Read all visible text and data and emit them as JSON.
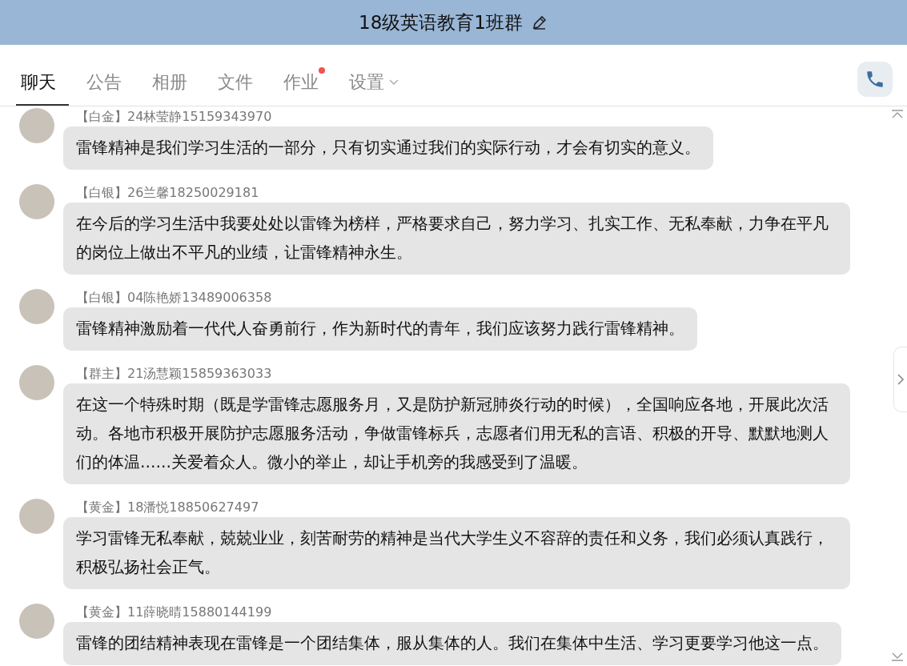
{
  "window": {
    "title": "18级英语教育1班群"
  },
  "tabs": [
    {
      "label": "聊天",
      "selected": true,
      "has_dot": false,
      "has_menu": false
    },
    {
      "label": "公告",
      "selected": false,
      "has_dot": false,
      "has_menu": false
    },
    {
      "label": "相册",
      "selected": false,
      "has_dot": false,
      "has_menu": false
    },
    {
      "label": "文件",
      "selected": false,
      "has_dot": false,
      "has_menu": false
    },
    {
      "label": "作业",
      "selected": false,
      "has_dot": true,
      "has_menu": false
    },
    {
      "label": "设置",
      "selected": false,
      "has_dot": false,
      "has_menu": true
    }
  ],
  "messages": [
    {
      "sender": "【白金】24林莹静15159343970",
      "text": "雷锋精神是我们学习生活的一部分，只有切实通过我们的实际行动，才会有切实的意义。"
    },
    {
      "sender": "【白银】26兰馨18250029181",
      "text": "在今后的学习生活中我要处处以雷锋为榜样，严格要求自己，努力学习、扎实工作、无私奉献，力争在平凡的岗位上做出不平凡的业绩，让雷锋精神永生。"
    },
    {
      "sender": "【白银】04陈艳娇13489006358",
      "text": "雷锋精神激励着一代代人奋勇前行，作为新时代的青年，我们应该努力践行雷锋精神。"
    },
    {
      "sender": "【群主】21汤慧颖15859363033",
      "text": "在这一个特殊时期（既是学雷锋志愿服务月，又是防护新冠肺炎行动的时候），全国响应各地，开展此次活动。各地市积极开展防护志愿服务活动，争做雷锋标兵，志愿者们用无私的言语、积极的开导、默默地测人们的体温……关爱着众人。微小的举止，却让手机旁的我感受到了温暖。"
    },
    {
      "sender": "【黄金】18潘悦18850627497",
      "text": "学习雷锋无私奉献，兢兢业业，刻苦耐劳的精神是当代大学生义不容辞的责任和义务，我们必须认真践行，积极弘扬社会正气。"
    },
    {
      "sender": "【黄金】11薛晓晴15880144199",
      "text": "雷锋的团结精神表现在雷锋是一个团结集体，服从集体的人。我们在集体中生活、学习更要学习他这一点。"
    }
  ]
}
